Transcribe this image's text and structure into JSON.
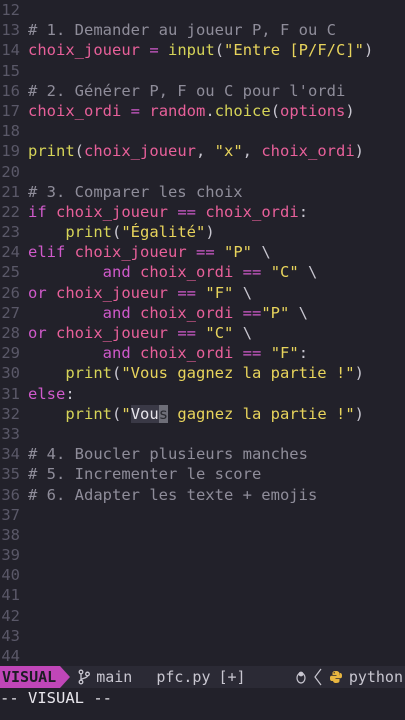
{
  "editor": {
    "lines": [
      {
        "n": "12",
        "tokens": []
      },
      {
        "n": "13",
        "tokens": [
          {
            "t": "# 1. Demander au joueur P, F ou C",
            "c": "cmt"
          }
        ]
      },
      {
        "n": "14",
        "tokens": [
          {
            "t": "choix_joueur",
            "c": "var"
          },
          {
            "t": " ",
            "c": "plain"
          },
          {
            "t": "=",
            "c": "op"
          },
          {
            "t": " ",
            "c": "plain"
          },
          {
            "t": "input",
            "c": "fn"
          },
          {
            "t": "(",
            "c": "punc"
          },
          {
            "t": "\"Entre [P/F/C]\"",
            "c": "str"
          },
          {
            "t": ")",
            "c": "punc"
          }
        ]
      },
      {
        "n": "15",
        "tokens": []
      },
      {
        "n": "16",
        "tokens": [
          {
            "t": "# 2. Générer P, F ou C pour l'ordi",
            "c": "cmt"
          }
        ]
      },
      {
        "n": "17",
        "tokens": [
          {
            "t": "choix_ordi",
            "c": "var"
          },
          {
            "t": " ",
            "c": "plain"
          },
          {
            "t": "=",
            "c": "op"
          },
          {
            "t": " ",
            "c": "plain"
          },
          {
            "t": "random",
            "c": "var"
          },
          {
            "t": ".",
            "c": "punc"
          },
          {
            "t": "choice",
            "c": "fn"
          },
          {
            "t": "(",
            "c": "punc"
          },
          {
            "t": "options",
            "c": "var"
          },
          {
            "t": ")",
            "c": "punc"
          }
        ]
      },
      {
        "n": "18",
        "tokens": []
      },
      {
        "n": "19",
        "tokens": [
          {
            "t": "print",
            "c": "fn"
          },
          {
            "t": "(",
            "c": "punc"
          },
          {
            "t": "choix_joueur",
            "c": "var"
          },
          {
            "t": ", ",
            "c": "punc"
          },
          {
            "t": "\"x\"",
            "c": "str"
          },
          {
            "t": ", ",
            "c": "punc"
          },
          {
            "t": "choix_ordi",
            "c": "var"
          },
          {
            "t": ")",
            "c": "punc"
          }
        ]
      },
      {
        "n": "20",
        "tokens": []
      },
      {
        "n": "21",
        "tokens": [
          {
            "t": "# 3. Comparer les choix",
            "c": "cmt"
          }
        ]
      },
      {
        "n": "22",
        "tokens": [
          {
            "t": "if",
            "c": "kw"
          },
          {
            "t": " ",
            "c": "plain"
          },
          {
            "t": "choix_joueur",
            "c": "var"
          },
          {
            "t": " ",
            "c": "plain"
          },
          {
            "t": "==",
            "c": "op"
          },
          {
            "t": " ",
            "c": "plain"
          },
          {
            "t": "choix_ordi",
            "c": "var"
          },
          {
            "t": ":",
            "c": "punc"
          }
        ]
      },
      {
        "n": "23",
        "tokens": [
          {
            "t": "    ",
            "c": "plain"
          },
          {
            "t": "print",
            "c": "fn"
          },
          {
            "t": "(",
            "c": "punc"
          },
          {
            "t": "\"Égalité\"",
            "c": "str"
          },
          {
            "t": ")",
            "c": "punc"
          }
        ]
      },
      {
        "n": "24",
        "tokens": [
          {
            "t": "elif",
            "c": "kw"
          },
          {
            "t": " ",
            "c": "plain"
          },
          {
            "t": "choix_joueur",
            "c": "var"
          },
          {
            "t": " ",
            "c": "plain"
          },
          {
            "t": "==",
            "c": "op"
          },
          {
            "t": " ",
            "c": "plain"
          },
          {
            "t": "\"P\"",
            "c": "str"
          },
          {
            "t": " \\",
            "c": "punc"
          }
        ]
      },
      {
        "n": "25",
        "tokens": [
          {
            "t": "        ",
            "c": "plain"
          },
          {
            "t": "and",
            "c": "kw"
          },
          {
            "t": " ",
            "c": "plain"
          },
          {
            "t": "choix_ordi",
            "c": "var"
          },
          {
            "t": " ",
            "c": "plain"
          },
          {
            "t": "==",
            "c": "op"
          },
          {
            "t": " ",
            "c": "plain"
          },
          {
            "t": "\"C\"",
            "c": "str"
          },
          {
            "t": " \\",
            "c": "punc"
          }
        ]
      },
      {
        "n": "26",
        "tokens": [
          {
            "t": "or",
            "c": "kw"
          },
          {
            "t": " ",
            "c": "plain"
          },
          {
            "t": "choix_joueur",
            "c": "var"
          },
          {
            "t": " ",
            "c": "plain"
          },
          {
            "t": "==",
            "c": "op"
          },
          {
            "t": " ",
            "c": "plain"
          },
          {
            "t": "\"F\"",
            "c": "str"
          },
          {
            "t": " \\",
            "c": "punc"
          }
        ]
      },
      {
        "n": "27",
        "tokens": [
          {
            "t": "        ",
            "c": "plain"
          },
          {
            "t": "and",
            "c": "kw"
          },
          {
            "t": " ",
            "c": "plain"
          },
          {
            "t": "choix_ordi",
            "c": "var"
          },
          {
            "t": " ",
            "c": "plain"
          },
          {
            "t": "==",
            "c": "op"
          },
          {
            "t": "\"P\"",
            "c": "str"
          },
          {
            "t": " \\",
            "c": "punc"
          }
        ]
      },
      {
        "n": "28",
        "tokens": [
          {
            "t": "or",
            "c": "kw"
          },
          {
            "t": " ",
            "c": "plain"
          },
          {
            "t": "choix_joueur",
            "c": "var"
          },
          {
            "t": " ",
            "c": "plain"
          },
          {
            "t": "==",
            "c": "op"
          },
          {
            "t": " ",
            "c": "plain"
          },
          {
            "t": "\"C\"",
            "c": "str"
          },
          {
            "t": " \\",
            "c": "punc"
          }
        ]
      },
      {
        "n": "29",
        "tokens": [
          {
            "t": "        ",
            "c": "plain"
          },
          {
            "t": "and",
            "c": "kw"
          },
          {
            "t": " ",
            "c": "plain"
          },
          {
            "t": "choix_ordi",
            "c": "var"
          },
          {
            "t": " ",
            "c": "plain"
          },
          {
            "t": "==",
            "c": "op"
          },
          {
            "t": " ",
            "c": "plain"
          },
          {
            "t": "\"F\"",
            "c": "str"
          },
          {
            "t": ":",
            "c": "punc"
          }
        ]
      },
      {
        "n": "30",
        "tokens": [
          {
            "t": "    ",
            "c": "plain"
          },
          {
            "t": "print",
            "c": "fn"
          },
          {
            "t": "(",
            "c": "punc"
          },
          {
            "t": "\"Vous gagnez la partie !\"",
            "c": "str"
          },
          {
            "t": ")",
            "c": "punc"
          }
        ]
      },
      {
        "n": "31",
        "tokens": [
          {
            "t": "else",
            "c": "kw"
          },
          {
            "t": ":",
            "c": "punc"
          }
        ]
      },
      {
        "n": "32",
        "tokens": [
          {
            "t": "    ",
            "c": "plain"
          },
          {
            "t": "print",
            "c": "fn"
          },
          {
            "t": "(",
            "c": "punc"
          },
          {
            "t": "\"",
            "c": "str"
          },
          {
            "t": "Vou",
            "c": "sel"
          },
          {
            "t": "s",
            "c": "cursor"
          },
          {
            "t": " gagnez la partie !\"",
            "c": "str"
          },
          {
            "t": ")",
            "c": "punc"
          }
        ]
      },
      {
        "n": "33",
        "tokens": []
      },
      {
        "n": "34",
        "tokens": [
          {
            "t": "# 4. Boucler plusieurs manches",
            "c": "cmt"
          }
        ]
      },
      {
        "n": "35",
        "tokens": [
          {
            "t": "# 5. Incrementer le score",
            "c": "cmt"
          }
        ]
      },
      {
        "n": "36",
        "tokens": [
          {
            "t": "# 6. Adapter les texte + emojis",
            "c": "cmt"
          }
        ]
      },
      {
        "n": "37",
        "tokens": []
      },
      {
        "n": "38",
        "tokens": []
      },
      {
        "n": "39",
        "tokens": []
      },
      {
        "n": "40",
        "tokens": []
      },
      {
        "n": "41",
        "tokens": []
      },
      {
        "n": "42",
        "tokens": []
      },
      {
        "n": "43",
        "tokens": []
      },
      {
        "n": "44",
        "tokens": []
      }
    ]
  },
  "statusbar": {
    "mode": "VISUAL",
    "branch": "main",
    "filename": "pfc.py",
    "modified": "[+]",
    "filetype": "python",
    "colors": {
      "mode_bg": "#c046b8",
      "bar_bg": "#2b2a35"
    },
    "icons": [
      "git-branch-icon",
      "linux-tux-icon",
      "chevron-left-icon",
      "python-icon"
    ]
  },
  "cmdline": {
    "text": "-- VISUAL --"
  }
}
